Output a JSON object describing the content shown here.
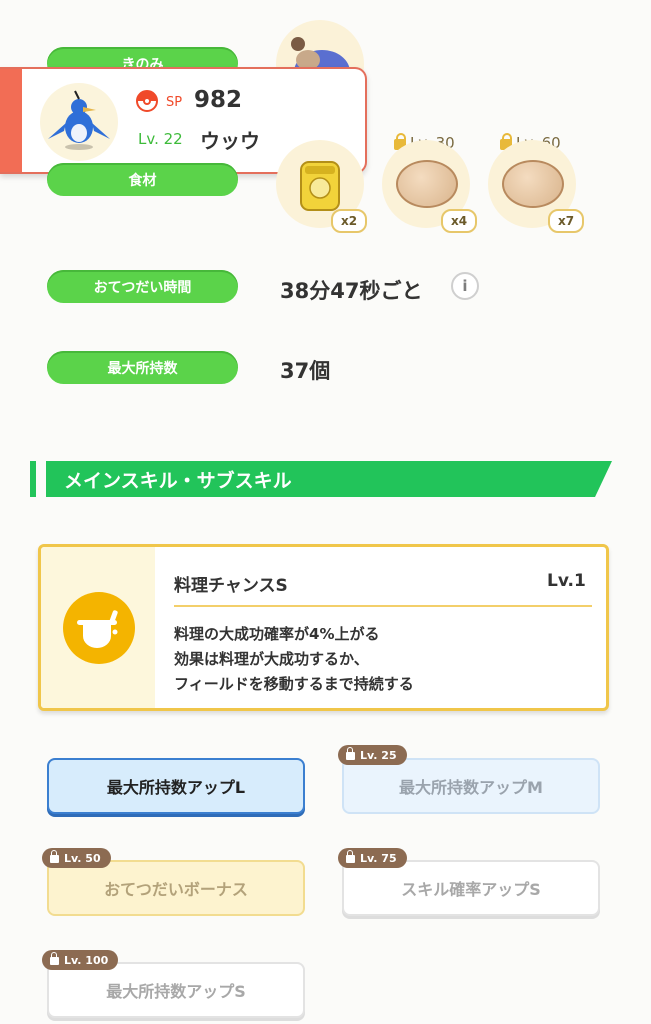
{
  "labels": {
    "berry": "きのみ",
    "ingredients": "食材",
    "help_time": "おてつだい時間",
    "max_carry": "最大所持数"
  },
  "values": {
    "help_time": "38分47秒ごと",
    "max_carry": "37個"
  },
  "pokemon": {
    "sp_label": "SP",
    "sp": "982",
    "level": "Lv. 22",
    "name": "ウッウ"
  },
  "ingredients": [
    {
      "lock": "",
      "qty": "x2",
      "icon": "honey-jar-icon"
    },
    {
      "lock": "Lv. 30",
      "qty": "x4",
      "icon": "potato-icon"
    },
    {
      "lock": "Lv. 60",
      "qty": "x7",
      "icon": "potato-icon"
    }
  ],
  "section": {
    "title": "メインスキル・サブスキル"
  },
  "main_skill": {
    "name": "料理チャンスS",
    "level": "Lv.1",
    "desc1": "料理の大成功確率が4%上がる",
    "desc2": "効果は料理が大成功するか、",
    "desc3": "フィールドを移動するまで持続する"
  },
  "sub_skills": [
    {
      "label": "最大所持数アップL",
      "lock": ""
    },
    {
      "label": "最大所持数アップM",
      "lock": "Lv. 25"
    },
    {
      "label": "おてつだいボーナス",
      "lock": "Lv. 50"
    },
    {
      "label": "スキル確率アップS",
      "lock": "Lv. 75"
    },
    {
      "label": "最大所持数アップS",
      "lock": "Lv. 100"
    }
  ],
  "colors": {
    "pill_green": "#5bd34a",
    "section_green": "#22c45a",
    "accent_red": "#f26d55",
    "skill_yellow": "#f4b400"
  }
}
